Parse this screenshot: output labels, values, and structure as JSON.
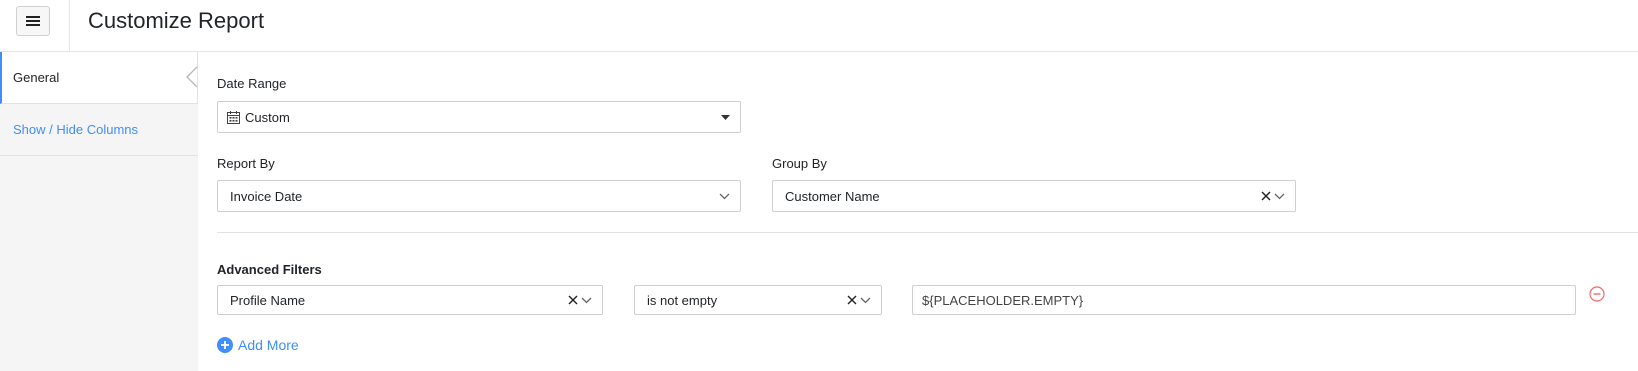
{
  "header": {
    "menu_icon": "hamburger-icon",
    "title": "Customize Report"
  },
  "sidebar": {
    "collapse_icon": "chevron-left-icon",
    "items": [
      {
        "label": "General",
        "active": true
      },
      {
        "label": "Show / Hide Columns",
        "active": false
      }
    ]
  },
  "form": {
    "date_range": {
      "label": "Date Range",
      "value": "Custom",
      "icon": "calendar-icon",
      "dropdown_icon": "caret-down-icon"
    },
    "report_by": {
      "label": "Report By",
      "value": "Invoice Date",
      "dropdown_icon": "chevron-down-icon"
    },
    "group_by": {
      "label": "Group By",
      "value": "Customer Name",
      "clear_icon": "close-icon",
      "dropdown_icon": "chevron-down-icon"
    },
    "advanced_filters": {
      "label": "Advanced Filters",
      "field": {
        "value": "Profile Name"
      },
      "comparator": {
        "value": "is not empty"
      },
      "value_input": {
        "value": "${PLACEHOLDER.EMPTY}"
      },
      "remove_icon": "minus-circle-icon",
      "add_more_label": "Add More",
      "add_more_icon": "plus-circle-icon"
    }
  },
  "colors": {
    "accent": "#408dfb",
    "danger": "#f26a6a",
    "sidebar_bg": "#f5f5f5",
    "border": "#cfcfcf"
  }
}
